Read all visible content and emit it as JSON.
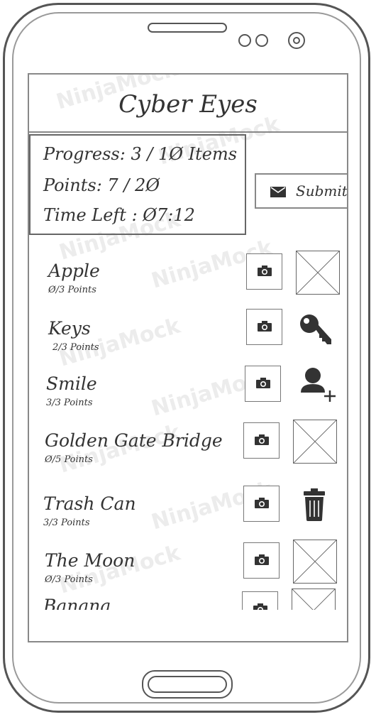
{
  "app": {
    "title": "Cyber Eyes",
    "watermark": "NinjaMock"
  },
  "stats": {
    "progress": "Progress: 3 / 1Ø Items",
    "points": "Points: 7 / 2Ø",
    "time_left": "Time Left : Ø7:12"
  },
  "submit": {
    "label": "Submit",
    "icon": "envelope-icon"
  },
  "items": [
    {
      "name": "Apple",
      "points": "Ø/3 Points",
      "status_icon": "image-placeholder"
    },
    {
      "name": "Keys",
      "points": "2/3 Points",
      "status_icon": "key-icon"
    },
    {
      "name": "Smile",
      "points": "3/3 Points",
      "status_icon": "add-user-icon"
    },
    {
      "name": "Golden Gate Bridge",
      "points": "Ø/5 Points",
      "status_icon": "image-placeholder"
    },
    {
      "name": "Trash Can",
      "points": "3/3 Points",
      "status_icon": "trash-icon"
    },
    {
      "name": "The Moon",
      "points": "Ø/3 Points",
      "status_icon": "image-placeholder"
    },
    {
      "name": "Banana",
      "points": "",
      "status_icon": "image-placeholder"
    }
  ],
  "colors": {
    "ink": "#333333",
    "frame": "#555555",
    "watermark": "#ececec"
  }
}
